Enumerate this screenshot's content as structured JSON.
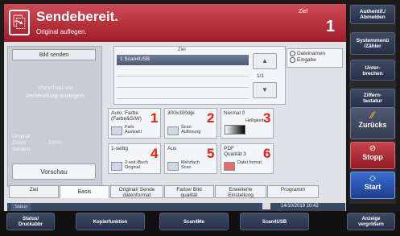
{
  "header": {
    "title": "Sendebereit.",
    "subtitle": "Original auflegen.",
    "ziel_label": "Ziel",
    "ziel_count": "1"
  },
  "left_panel": {
    "send_image_btn": "Bild senden",
    "preview_hint_line1": "Vorschau vor",
    "preview_hint_line2": "Versendung anzeigen.",
    "original_label": "Original",
    "zoom_label": "Zoom",
    "zoom_value": "100%",
    "senden_label": "Senden",
    "preview_btn": "Vorschau"
  },
  "destination": {
    "column_header": "Ziel",
    "first_entry": "1 Scan4USB",
    "page_indicator": "1/1",
    "opt_dateiname": "Dateinamen",
    "opt_eingabe": "Eingabe"
  },
  "tiles": [
    {
      "top": "Auto. Farbe (Farbe&S/W)",
      "label_line1": "Farb",
      "label_line2": "Auswahl",
      "num": "1"
    },
    {
      "top": "300x300dpi",
      "label_line1": "Scan",
      "label_line2": "Auflösung",
      "num": "2"
    },
    {
      "top": "Normal 0",
      "label_line1": "Helligkeit",
      "label_line2": "",
      "num": "3"
    },
    {
      "top": "1-seitig",
      "label_line1": "2-seit./Buch",
      "label_line2": "Original",
      "num": "4"
    },
    {
      "top": "Aus",
      "label_line1": "Mehrfach",
      "label_line2": "Scan",
      "num": "5"
    },
    {
      "top": "PDF",
      "top2": "Qualität 3",
      "label_line1": "Datei format",
      "label_line2": "",
      "num": "6"
    }
  ],
  "tabs": [
    {
      "line1": "Ziel",
      "line2": ""
    },
    {
      "line1": "Basis",
      "line2": ""
    },
    {
      "line1": "Original/ Sende",
      "line2": "datenformat"
    },
    {
      "line1": "Farbe/ Bild",
      "line2": "qualität"
    },
    {
      "line1": "Erweiterte",
      "line2": "Einstellung"
    },
    {
      "line1": "Programm",
      "line2": ""
    }
  ],
  "status": {
    "label": "Status",
    "datetime": "14/10/2019  10:42"
  },
  "side_buttons": {
    "auth_line1": "Authentif./",
    "auth_line2": "Abmelden",
    "system_line1": "Systemmenü",
    "system_line2": "/Zähler",
    "unter_line1": "Unter-",
    "unter_line2": "brechen",
    "ziffer_line1": "Ziffern-",
    "ziffer_line2": "tastatur",
    "back": "Zurücks",
    "stop": "Stopp",
    "start": "Start"
  },
  "bottom_bar": {
    "status_line1": "Status/",
    "status_line2": "Druckabbr",
    "copy": "Kopierfunktion",
    "scan4me": "Scan4Me",
    "scan4usb": "Scan4USB",
    "anzeige_line1": "Anzeige",
    "anzeige_line2": "vergrößern"
  }
}
